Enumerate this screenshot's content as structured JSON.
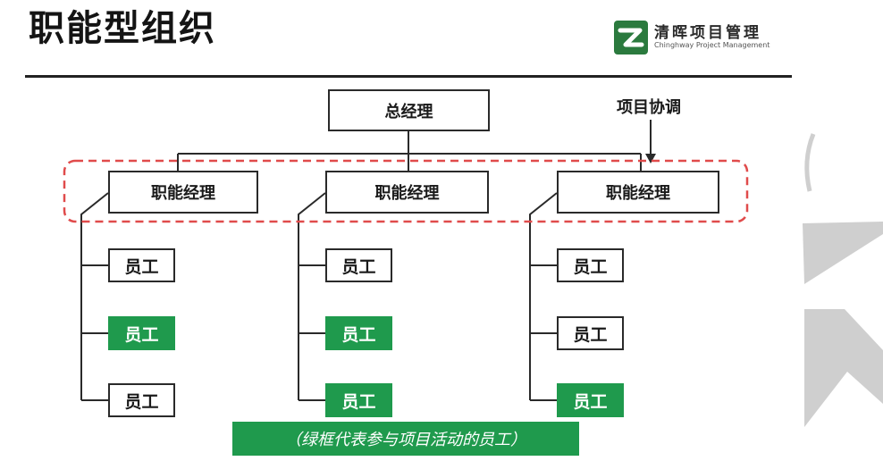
{
  "header": {
    "title": "职能型组织",
    "logo_name": "清晖项目管理",
    "logo_subtitle": "Chinghway Project Management"
  },
  "colors": {
    "green": "#1f9a4d",
    "dash_red": "#e04b4b",
    "line": "#2a2a2a"
  },
  "diagram": {
    "top_box": "总经理",
    "coordination_label": "项目协调",
    "managers": [
      "职能经理",
      "职能经理",
      "职能经理"
    ],
    "columns": [
      {
        "staff": [
          {
            "label": "员工",
            "green": false
          },
          {
            "label": "员工",
            "green": true
          },
          {
            "label": "员工",
            "green": false
          }
        ]
      },
      {
        "staff": [
          {
            "label": "员工",
            "green": false
          },
          {
            "label": "员工",
            "green": true
          },
          {
            "label": "员工",
            "green": true
          }
        ]
      },
      {
        "staff": [
          {
            "label": "员工",
            "green": false
          },
          {
            "label": "员工",
            "green": false
          },
          {
            "label": "员工",
            "green": true
          }
        ]
      }
    ]
  },
  "legend": "（绿框代表参与项目活动的员工）"
}
